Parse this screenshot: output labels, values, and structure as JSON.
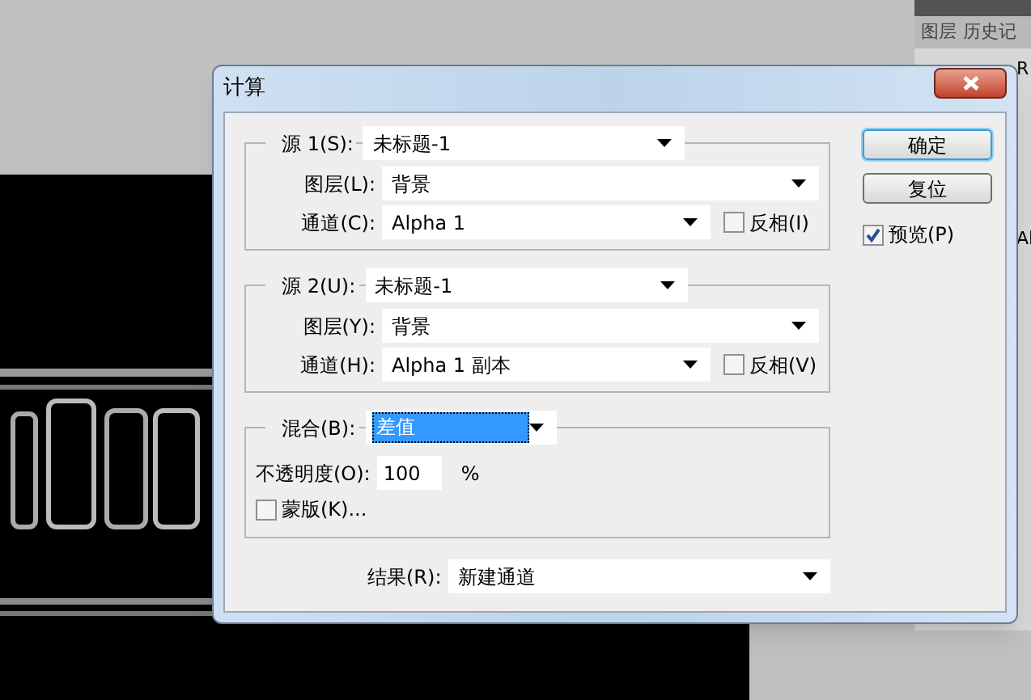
{
  "window": {
    "title": "计算"
  },
  "source_1": {
    "label": "源 1(S):",
    "value": "未标题-1",
    "layer_label": "图层(L):",
    "layer": "背景",
    "channel_label": "通道(C):",
    "channel": "Alpha 1",
    "invert": {
      "label": "反相(I)",
      "checked": false
    }
  },
  "source_2": {
    "label": "源 2(U):",
    "value": "未标题-1",
    "layer_label": "图层(Y):",
    "layer": "背景",
    "channel_label": "通道(H):",
    "channel": "Alpha 1 副本",
    "invert": {
      "label": "反相(V)",
      "checked": false
    }
  },
  "blending": {
    "label": "混合(B):",
    "value": "差值",
    "highlighted": true,
    "opacity_label": "不透明度(O):",
    "opacity": "100",
    "unit": "%",
    "mask": {
      "label": "蒙版(K)...",
      "checked": false
    }
  },
  "result": {
    "label": "结果(R):",
    "value": "新建通道"
  },
  "buttons": [
    {
      "label": "确定",
      "default": true
    },
    {
      "label": "复位",
      "default": false
    }
  ],
  "preview": {
    "label": "预览(P)",
    "checked": true
  },
  "background_panel": {
    "tabs": [
      "图层",
      "历史记"
    ],
    "rows": [
      "R",
      "Al"
    ]
  }
}
